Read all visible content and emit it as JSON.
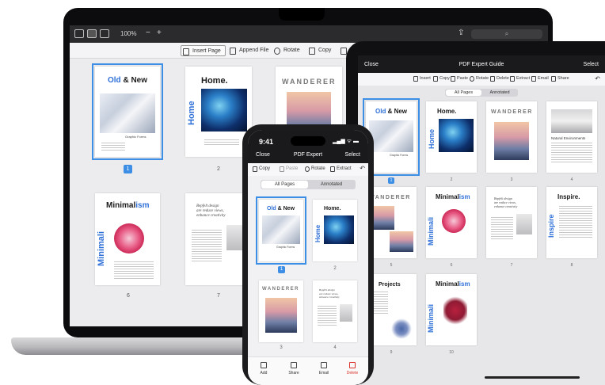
{
  "laptop": {
    "menubar": {
      "zoom": "100%",
      "minus": "−",
      "plus": "+"
    },
    "toolbar": {
      "insert_page": "Insert Page",
      "append_file": "Append File",
      "rotate": "Rotate",
      "copy": "Copy"
    },
    "pages": [
      {
        "num": "1",
        "title_a": "Old",
        "title_b": " & New",
        "caption": "Graphic Forms"
      },
      {
        "num": "2",
        "title": "Home.",
        "vertical": "Home"
      },
      {
        "num": "",
        "title": "WANDERER"
      },
      {
        "num": "6",
        "title_a": "Minimal",
        "title_b": "ism",
        "vertical": "Minimali"
      },
      {
        "num": "7",
        "quote": "Bepfelt design\nare reduce views,\nenhance creativity"
      }
    ]
  },
  "tablet": {
    "nav": {
      "close": "Close",
      "title": "PDF Expert Guide",
      "select": "Select"
    },
    "tools": {
      "insert": "Insert",
      "copy": "Copy",
      "paste": "Paste",
      "rotate": "Rotate",
      "delete": "Delete",
      "extract": "Extract",
      "email": "Email",
      "share": "Share"
    },
    "segments": {
      "all": "All Pages",
      "annotated": "Annotated"
    },
    "pages": [
      {
        "num": "1",
        "title_a": "Old",
        "title_b": " & New",
        "caption": "Graphic Forms"
      },
      {
        "num": "2",
        "title": "Home.",
        "vertical": "Home"
      },
      {
        "num": "3",
        "title": "WANDERER"
      },
      {
        "num": "4",
        "title": "Natural Environments"
      },
      {
        "num": "5",
        "title": "WANDERER"
      },
      {
        "num": "6",
        "title_a": "Minimal",
        "title_b": "ism",
        "vertical": "Minimali"
      },
      {
        "num": "7",
        "quote": "Bepfelt design\nare reduce views,\nenhance creativity"
      },
      {
        "num": "8",
        "title": "Inspire.",
        "vertical": "Inspire"
      },
      {
        "num": "9",
        "title": "Projects"
      },
      {
        "num": "10",
        "title_a": "Minimal",
        "title_b": "ism",
        "vertical": "Minimali"
      }
    ]
  },
  "phone": {
    "status": {
      "time": "9:41",
      "signal": "▂▄▆ ᯤ ▬"
    },
    "nav": {
      "close": "Close",
      "title": "PDF Expert",
      "select": "Select"
    },
    "tools": {
      "copy": "Copy",
      "paste": "Paste",
      "rotate": "Rotate",
      "extract": "Extract"
    },
    "segments": {
      "all": "All Pages",
      "annotated": "Annotated"
    },
    "pages": [
      {
        "num": "1",
        "title_a": "Old",
        "title_b": " & New",
        "caption": "Graphic Forms"
      },
      {
        "num": "2",
        "title": "Home.",
        "vertical": "Home"
      },
      {
        "num": "3",
        "title": "WANDERER"
      },
      {
        "num": "4",
        "quote": "Bepfelt design\nare reduce views,\nenhance creativity"
      }
    ],
    "bottom": {
      "add": "Add",
      "share": "Share",
      "email": "Email",
      "delete": "Delete"
    }
  },
  "colors": {
    "accent": "#3d8fe6",
    "brand_blue": "#2f70d8",
    "delete": "#d9342b"
  }
}
